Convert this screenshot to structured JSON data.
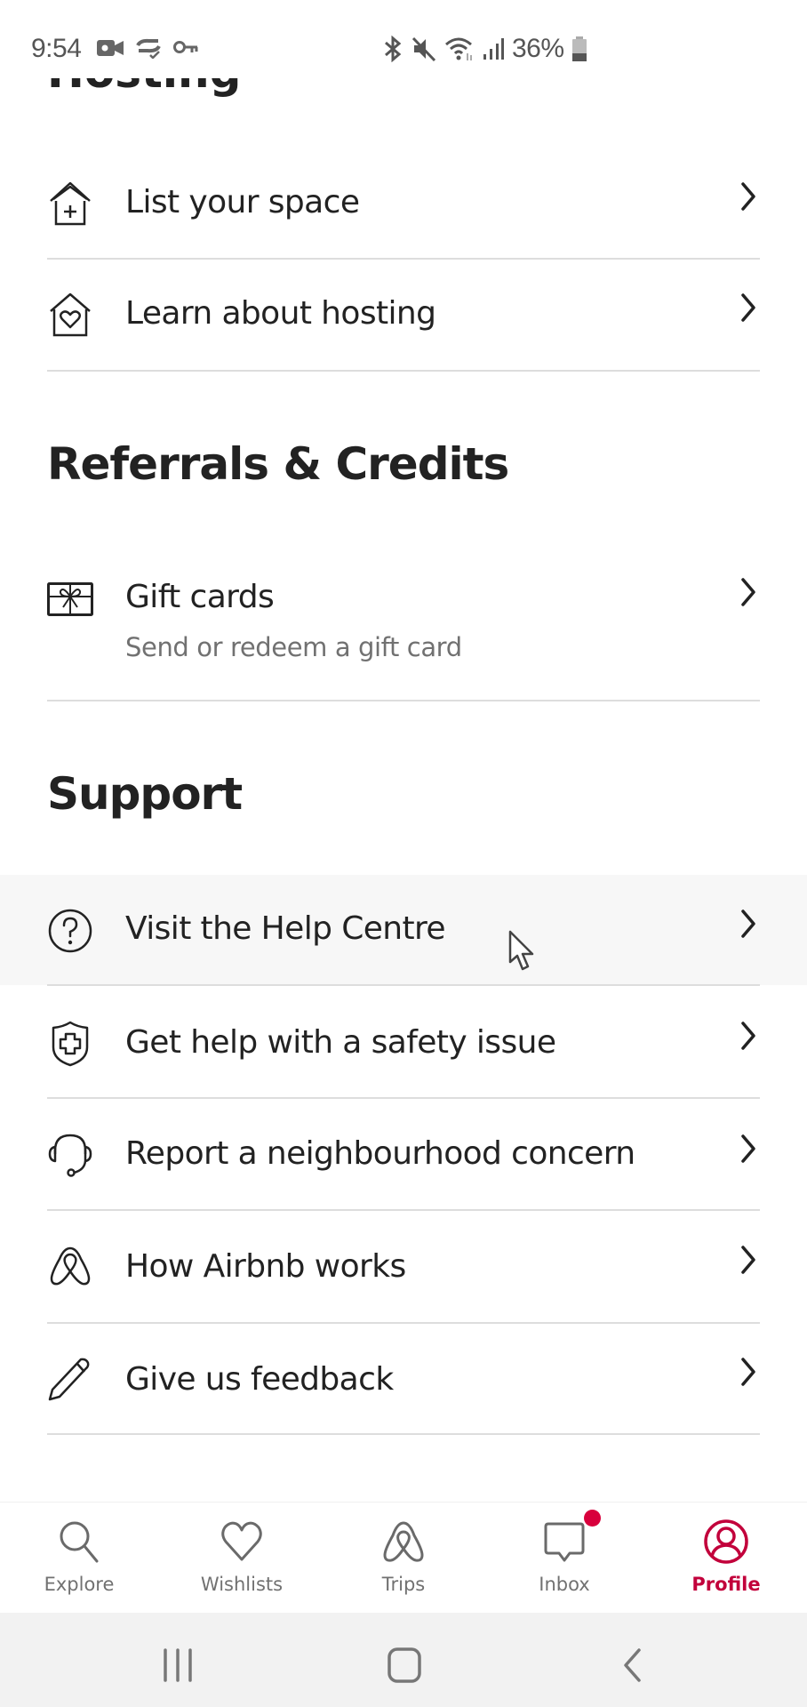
{
  "status_bar": {
    "time": "9:54",
    "left_icons": [
      "video-call-icon",
      "sync-check-icon",
      "key-icon"
    ],
    "right_icons": [
      "bluetooth-icon",
      "mute-icon",
      "wifi-icon",
      "signal-icon"
    ],
    "battery_percent": "36%",
    "battery_level": 0.36
  },
  "clipped_heading": "Hosting",
  "hosting": {
    "items": [
      {
        "label": "List your space",
        "icon": "house-plus-icon"
      },
      {
        "label": "Learn about hosting",
        "icon": "house-heart-icon"
      }
    ]
  },
  "referrals": {
    "heading": "Referrals & Credits",
    "items": [
      {
        "label": "Gift cards",
        "sublabel": "Send or redeem a gift card",
        "icon": "gift-card-icon"
      }
    ]
  },
  "support": {
    "heading": "Support",
    "items": [
      {
        "label": "Visit the Help Centre",
        "icon": "help-circle-icon",
        "highlighted": true
      },
      {
        "label": "Get help with a safety issue",
        "icon": "shield-plus-icon"
      },
      {
        "label": "Report a neighbourhood concern",
        "icon": "headset-icon"
      },
      {
        "label": "How Airbnb works",
        "icon": "airbnb-logo-icon"
      },
      {
        "label": "Give us feedback",
        "icon": "pencil-icon"
      }
    ]
  },
  "bottom_nav": {
    "items": [
      {
        "label": "Explore",
        "icon": "search-icon"
      },
      {
        "label": "Wishlists",
        "icon": "heart-icon"
      },
      {
        "label": "Trips",
        "icon": "airbnb-logo-icon"
      },
      {
        "label": "Inbox",
        "icon": "message-icon",
        "has_badge": true
      },
      {
        "label": "Profile",
        "icon": "profile-icon",
        "active": true
      }
    ]
  },
  "colors": {
    "accent": "#c2003b",
    "badge": "#d8003c",
    "text": "#222222",
    "secondary_text": "#717171",
    "divider": "#dddddd",
    "highlight_bg": "#f7f7f7",
    "system_nav_bg": "#f2f2f2"
  },
  "system_nav": {
    "buttons": [
      "recents-icon",
      "home-icon",
      "back-icon"
    ]
  }
}
